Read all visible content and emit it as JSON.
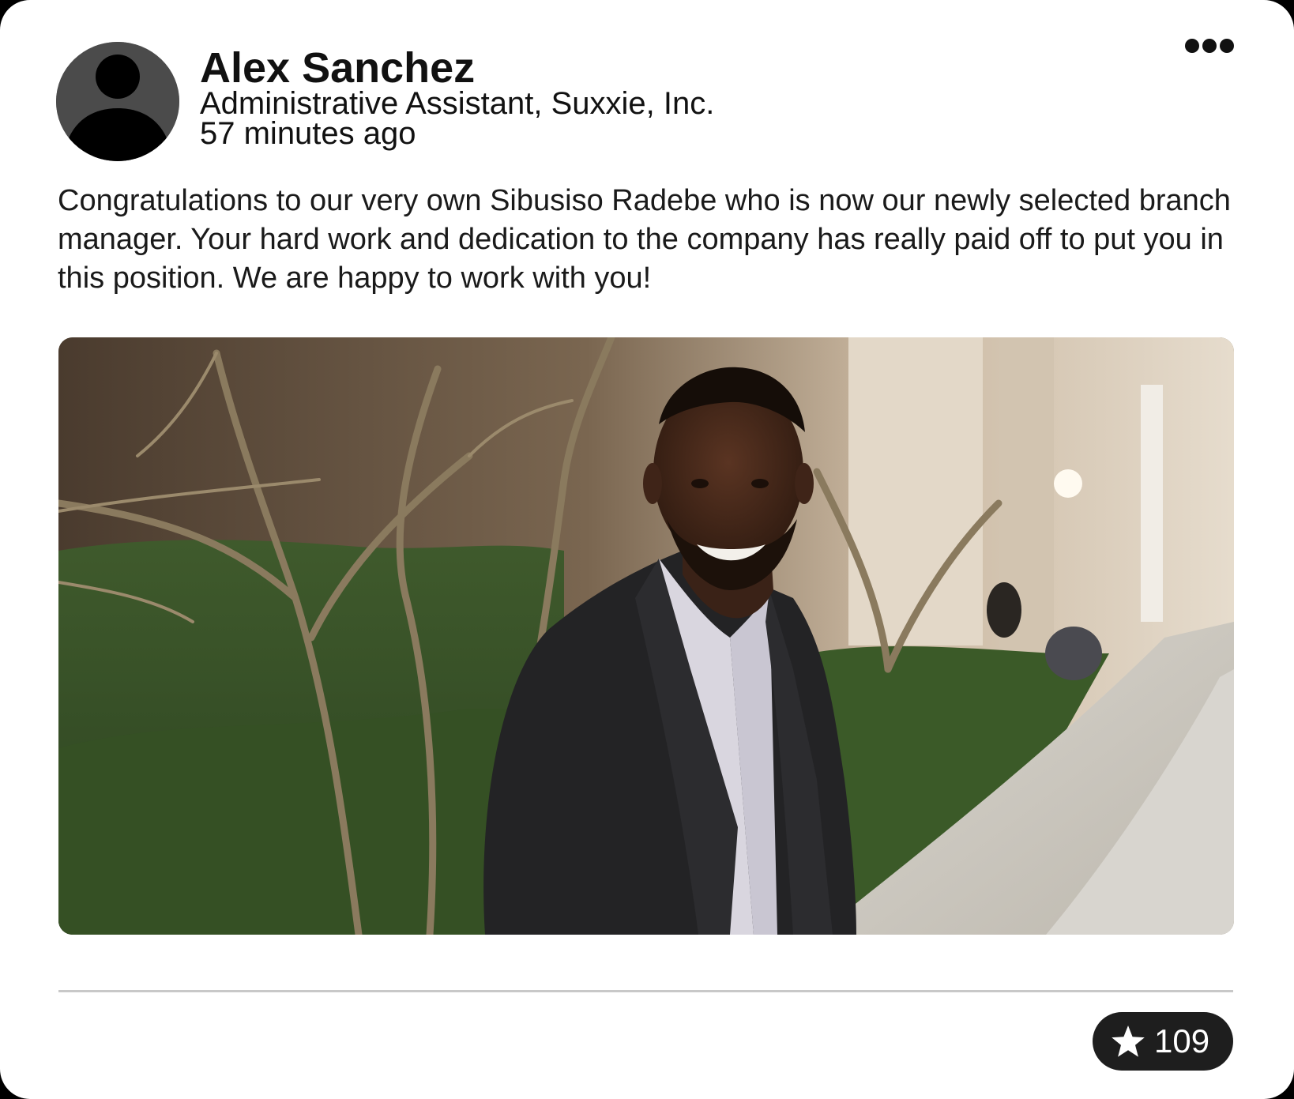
{
  "post": {
    "author": {
      "name": "Alex Sanchez",
      "title": "Administrative Assistant, Suxxie, Inc.",
      "avatar_icon": "person-silhouette-icon"
    },
    "timestamp": "57 minutes ago",
    "menu_icon": "more-horizontal-icon",
    "body": "Congratulations to our very own Sibusiso Radebe who is now our newly selected branch manager. Your hard work and dedication to the company has really paid off to put you in this position. We are happy to work with you!",
    "image": {
      "description_icon": "photo-smiling-man-in-suit-outdoors"
    },
    "reactions": {
      "star_icon": "star-icon",
      "star_count": "109"
    }
  },
  "colors": {
    "card_background": "#ffffff",
    "frame_background": "#000000",
    "text": "#111111",
    "divider": "#c8c8c8",
    "reaction_pill": "#1e1e1e",
    "avatar_background": "#4b4b4b"
  }
}
